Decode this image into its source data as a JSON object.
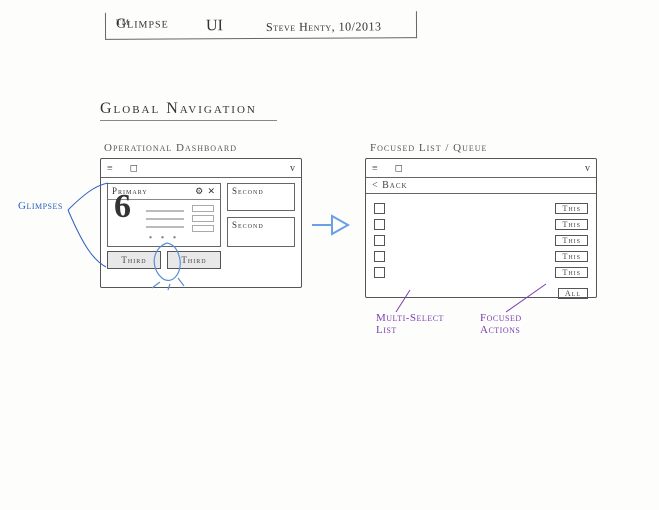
{
  "header": {
    "product": "Glimpse",
    "tm": "TM",
    "suffix": "UI",
    "byline": "Steve Henty, 10/2013"
  },
  "section_title": "Global Navigation",
  "left": {
    "caption": "Operational Dashboard",
    "primary_label": "Primary",
    "primary_value": "6",
    "second_a": "Second",
    "second_b": "Second",
    "third_a": "Third",
    "third_b": "Third"
  },
  "right": {
    "caption": "Focused List / Queue",
    "back": "< Back",
    "row_btn": "This",
    "all_btn": "All"
  },
  "annotations": {
    "glimpses": "Glimpses",
    "multi_select": "Multi-Select List",
    "focused_actions": "Focused Actions"
  },
  "titlebar": {
    "chevron": "v"
  }
}
